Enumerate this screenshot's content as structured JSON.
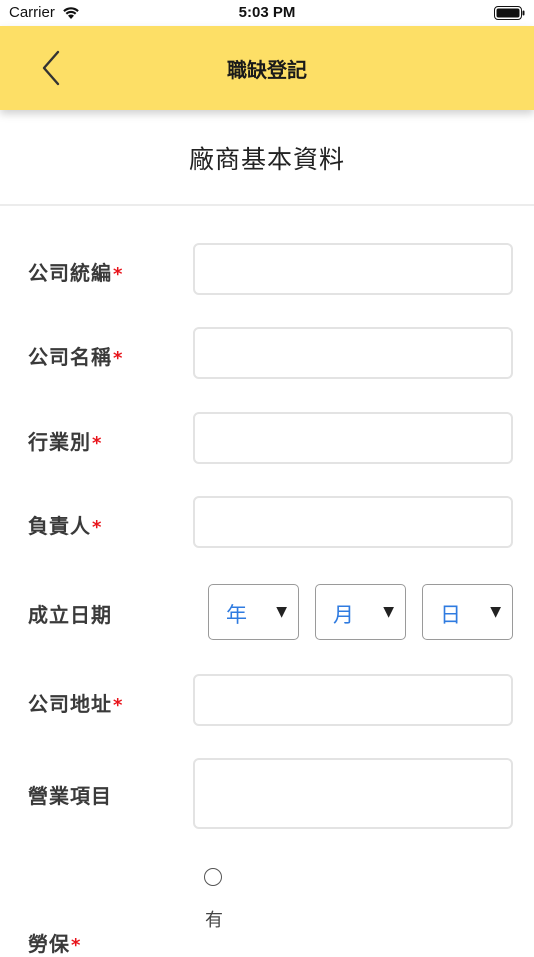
{
  "status_bar": {
    "carrier": "Carrier",
    "time": "5:03 PM"
  },
  "nav": {
    "title": "職缺登記",
    "back_icon": "chevron-left-icon"
  },
  "section": {
    "title": "廠商基本資料"
  },
  "form": {
    "required_mark": "*",
    "tax_id": {
      "label": "公司統編",
      "value": ""
    },
    "company_name": {
      "label": "公司名稱",
      "value": ""
    },
    "industry": {
      "label": "行業別",
      "value": ""
    },
    "owner": {
      "label": "負責人",
      "value": ""
    },
    "founded_date": {
      "label": "成立日期",
      "year": "年",
      "month": "月",
      "day": "日"
    },
    "address": {
      "label": "公司地址",
      "value": ""
    },
    "business_items": {
      "label": "營業項目",
      "value": ""
    },
    "labor_insurance": {
      "label": "勞保",
      "option_yes": "有",
      "selected": false
    }
  },
  "colors": {
    "nav_background": "#FDDF66",
    "required": "#e8141b",
    "select_text": "#2f7be0"
  }
}
